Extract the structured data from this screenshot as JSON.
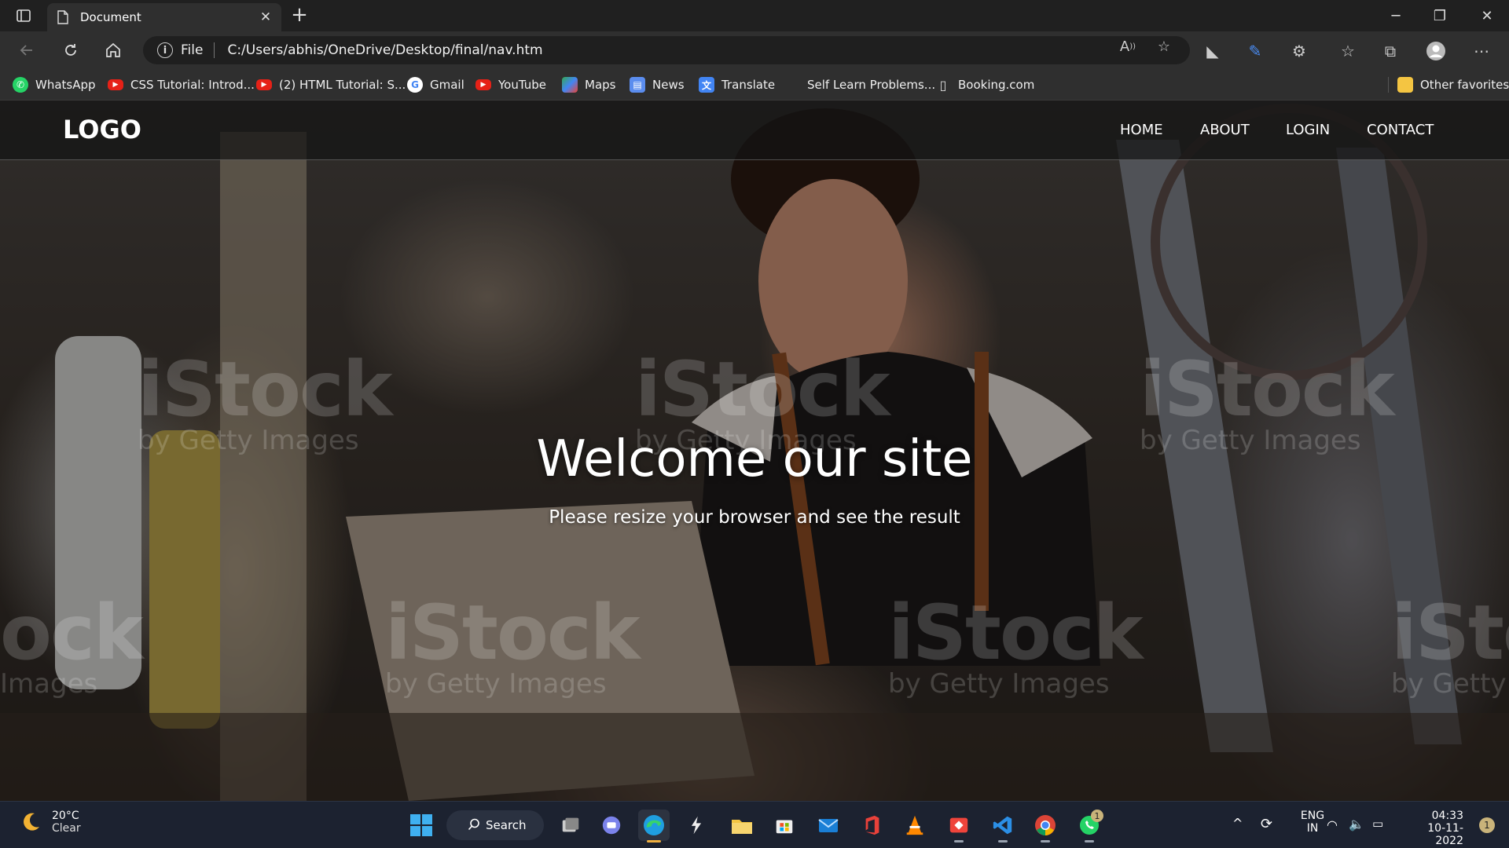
{
  "browser": {
    "tab_title": "Document",
    "address_scheme": "File",
    "address_url": "C:/Users/abhis/OneDrive/Desktop/final/nav.htm"
  },
  "favorites": [
    {
      "label": "WhatsApp",
      "icon": "whatsapp-icon"
    },
    {
      "label": "CSS Tutorial: Introd...",
      "icon": "youtube-icon"
    },
    {
      "label": "(2) HTML Tutorial: S...",
      "icon": "youtube-icon"
    },
    {
      "label": "Gmail",
      "icon": "google-icon"
    },
    {
      "label": "YouTube",
      "icon": "youtube-icon"
    },
    {
      "label": "Maps",
      "icon": "maps-icon"
    },
    {
      "label": "News",
      "icon": "news-icon"
    },
    {
      "label": "Translate",
      "icon": "translate-icon"
    },
    {
      "label": "Self Learn Problems...",
      "icon": ""
    },
    {
      "label": "Booking.com",
      "icon": "page-icon"
    },
    {
      "label": "Other favorites",
      "icon": "folder-icon"
    }
  ],
  "site": {
    "logo": "LOGO",
    "nav": [
      "HOME",
      "ABOUT",
      "LOGIN",
      "CONTACT"
    ],
    "hero_title": "Welcome our site",
    "hero_subtitle": "Please resize your browser and see the result",
    "watermark_brand": "iStock",
    "watermark_sub": "by Getty Images",
    "watermark_partial": "ock",
    "watermark_partial_sub": "Images",
    "watermark_edge_sub": "by Getty"
  },
  "taskbar": {
    "weather_temp": "20°C",
    "weather_desc": "Clear",
    "search_label": "Search",
    "whatsapp_badge": "1",
    "lang_top": "ENG",
    "lang_bottom": "IN",
    "time": "04:33",
    "date": "10-11-2022",
    "notification_count": "1"
  },
  "colors": {
    "taskbar_bg": "#1c2230",
    "browser_chrome": "#2f2f2f",
    "tab_strip": "#202020"
  }
}
